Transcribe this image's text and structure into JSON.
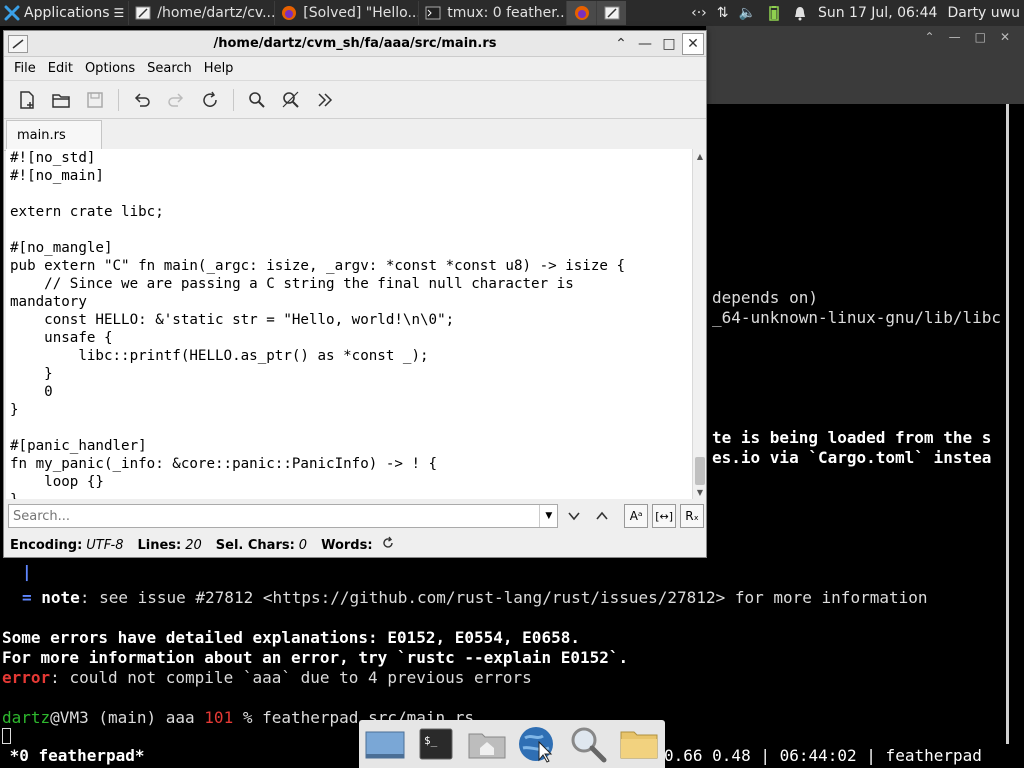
{
  "panel": {
    "apps_label": "Applications",
    "tasks": [
      {
        "label": "/home/dartz/cv..."
      },
      {
        "label": "[Solved] \"Hello..."
      },
      {
        "label": "tmux: 0 feather..."
      }
    ],
    "clock": "Sun 17 Jul, 06:44",
    "user": "Darty uwu"
  },
  "terminal": {
    "line_depends": "depends on)",
    "line_libc": "_64-unknown-linux-gnu/lib/libc",
    "line_loaded": "te is being loaded from the s",
    "line_cargo": "es.io via `Cargo.toml` instea",
    "pipe": "|",
    "note_eq": "=",
    "note_word": "note",
    "note_rest": ": see issue #27812 <https://github.com/rust-lang/rust/issues/27812> for more information",
    "explanations": "Some errors have detailed explanations: E0152, E0554, E0658.",
    "more_info": "For more information about an error, try `rustc --explain E0152`.",
    "error_word": "error",
    "error_rest": ": could not compile `aaa` due to 4 previous errors",
    "prompt_user": "dartz",
    "prompt_host": "@VM3 (main) aaa ",
    "prompt_code": "101",
    "prompt_cmd": " % featherpad src/main.rs",
    "tmux_left": " *0 featherpad*",
    "tmux_right": "0.66 0.48 | 06:44:02 | featherpad"
  },
  "featherpad": {
    "title": "/home/dartz/cvm_sh/fa/aaa/src/main.rs",
    "menu": [
      "File",
      "Edit",
      "Options",
      "Search",
      "Help"
    ],
    "tab": "main.rs",
    "code": [
      "#![no_std]",
      "#![no_main]",
      "",
      "extern crate libc;",
      "",
      "#[no_mangle]",
      "pub extern \"C\" fn main(_argc: isize, _argv: *const *const u8) -> isize {",
      "    // Since we are passing a C string the final null character is",
      "mandatory",
      "    const HELLO: &'static str = \"Hello, world!\\n\\0\";",
      "    unsafe {",
      "        libc::printf(HELLO.as_ptr() as *const _);",
      "    }",
      "    0",
      "}",
      "",
      "#[panic_handler]",
      "fn my_panic(_info: &core::panic::PanicInfo) -> ! {",
      "    loop {}",
      "}"
    ],
    "search_placeholder": "Search...",
    "status": {
      "encoding_label": "Encoding:",
      "encoding": "UTF-8",
      "lines_label": "Lines:",
      "lines": "20",
      "sel_label": "Sel. Chars:",
      "sel": "0",
      "words_label": "Words:"
    }
  },
  "colors": {
    "panel": "#2b2b2b",
    "terminal_bg": "#000000",
    "error_red": "#e53935",
    "prompt_green": "#2eb82e",
    "note_blue": "#5f87ff"
  }
}
